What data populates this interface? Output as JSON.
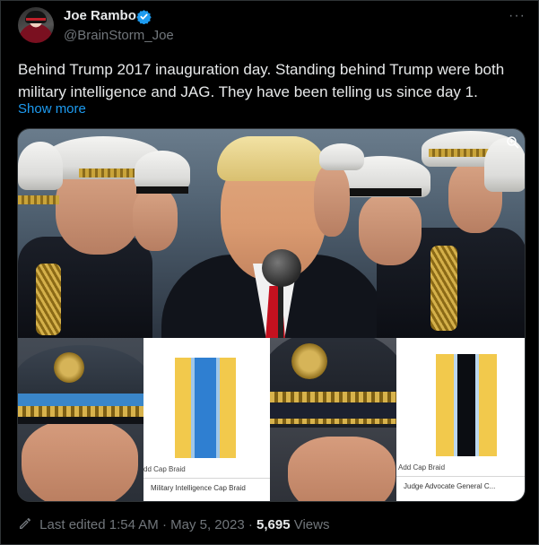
{
  "author": {
    "display_name": "Joe Rambo",
    "handle": "@BrainStorm_Joe",
    "verified": true,
    "avatar_icon": "profile-avatar"
  },
  "tweet": {
    "text_line1": "Behind Trump 2017 inauguration day. Standing behind Trump were both",
    "text_line2": "military intelligence and JAG.   They have been telling us since day 1.",
    "show_more": "Show more"
  },
  "media": {
    "panel2": {
      "small_label": "dd Cap Braid",
      "caption": "Military Intelligence Cap Braid"
    },
    "panel4": {
      "small_label": "Add Cap Braid",
      "caption": "Judge Advocate General C..."
    }
  },
  "footer": {
    "edited": "Last edited 1:54 AM",
    "dot1": "·",
    "date": "May 5, 2023",
    "dot2": "·",
    "views_count": "5,695",
    "views_label": "Views"
  },
  "colors": {
    "link": "#1d9bf0",
    "muted": "#71767b",
    "text": "#e7e9ea",
    "ribbon_gold": "#f2c94c",
    "ribbon_blue": "#2f7fd1",
    "ribbon_black": "#0b0d12"
  }
}
